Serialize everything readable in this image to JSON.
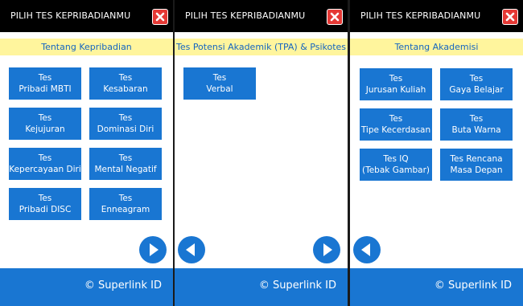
{
  "panels": [
    {
      "title": "PILIH TES KEPRIBADIANMU",
      "subtitle": "Tentang Kepribadian",
      "tiles": [
        {
          "line1": "Tes",
          "line2": "Pribadi MBTI"
        },
        {
          "line1": "Tes",
          "line2": "Kesabaran"
        },
        {
          "line1": "Tes",
          "line2": "Kejujuran"
        },
        {
          "line1": "Tes",
          "line2": "Dominasi Diri"
        },
        {
          "line1": "Tes",
          "line2": "Kepercayaan Diri"
        },
        {
          "line1": "Tes",
          "line2": "Mental Negatif"
        },
        {
          "line1": "Tes",
          "line2": "Pribadi DISC"
        },
        {
          "line1": "Tes",
          "line2": "Enneagram"
        }
      ],
      "footer": "© Superlink ID"
    },
    {
      "title": "PILIH TES KEPRIBADIANMU",
      "subtitle": "Tes Potensi Akademik (TPA) & Psikotes",
      "tiles": [
        {
          "line1": "Tes",
          "line2": "Verbal"
        }
      ],
      "footer": "© Superlink ID"
    },
    {
      "title": "PILIH TES KEPRIBADIANMU",
      "subtitle": "Tentang Akademisi",
      "tiles": [
        {
          "line1": "Tes",
          "line2": "Jurusan Kuliah"
        },
        {
          "line1": "Tes",
          "line2": "Gaya Belajar"
        },
        {
          "line1": "Tes",
          "line2": "Tipe Kecerdasan"
        },
        {
          "line1": "Tes",
          "line2": "Buta Warna"
        },
        {
          "line1": "Tes IQ",
          "line2": "(Tebak Gambar)"
        },
        {
          "line1": "Tes Rencana",
          "line2": "Masa Depan"
        }
      ],
      "footer": "© Superlink ID"
    }
  ],
  "icons": {
    "close": "close-icon",
    "prev": "chevron-left-icon",
    "next": "chevron-right-icon"
  },
  "colors": {
    "titlebar": "#000000",
    "subbar": "#fff59d",
    "subbar_text": "#1565c0",
    "tile": "#1976d2",
    "close": "#e53935",
    "footer": "#1976d2"
  }
}
